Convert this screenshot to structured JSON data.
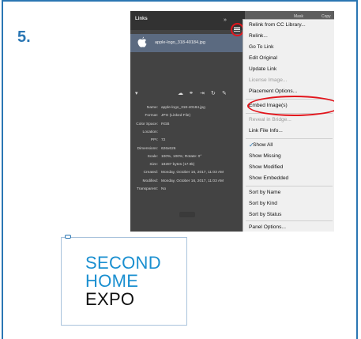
{
  "step_number": "5.",
  "panel": {
    "tab_label": "Links",
    "chevrons": "»",
    "link_filename": "apple-logo_318-40184.jpg",
    "info": [
      {
        "key": "Name:",
        "value": "apple-logo_318-40184.jpg"
      },
      {
        "key": "Format:",
        "value": "JPG (Linked File)"
      },
      {
        "key": "Color Space:",
        "value": "RGB"
      },
      {
        "key": "Location:",
        "value": ""
      },
      {
        "key": "PPI:",
        "value": "72"
      },
      {
        "key": "Dimensions:",
        "value": "626x626"
      },
      {
        "key": "Scale:",
        "value": "100%, 100%; Rotate: 0°"
      },
      {
        "key": "Size:",
        "value": "18287 bytes (17.9k)"
      },
      {
        "key": "Created:",
        "value": "Monday, October 16, 2017, 11:03 AM"
      },
      {
        "key": "Modified:",
        "value": "Monday, October 16, 2017, 11:03 AM"
      },
      {
        "key": "Transparent:",
        "value": "No"
      }
    ]
  },
  "background_columns": [
    "Mask",
    "Copy In"
  ],
  "menu": {
    "items": [
      {
        "label": "Relink from CC Library...",
        "disabled": false
      },
      {
        "label": "Relink...",
        "disabled": false
      },
      {
        "label": "Go To Link",
        "disabled": false
      },
      {
        "label": "Edit Original",
        "disabled": false
      },
      {
        "label": "Update Link",
        "disabled": false
      },
      {
        "label": "License Image...",
        "disabled": true
      },
      {
        "label": "Placement Options...",
        "disabled": false
      },
      {
        "label": "Embed Image(s)",
        "disabled": false
      },
      {
        "label": "Reveal in Bridge...",
        "disabled": true
      },
      {
        "label": "Link File Info...",
        "disabled": false
      },
      {
        "label": "Show All",
        "disabled": false,
        "checked": true
      },
      {
        "label": "Show Missing",
        "disabled": false
      },
      {
        "label": "Show Modified",
        "disabled": false
      },
      {
        "label": "Show Embedded",
        "disabled": false
      },
      {
        "label": "Sort by Name",
        "disabled": false
      },
      {
        "label": "Sort by Kind",
        "disabled": false
      },
      {
        "label": "Sort by Status",
        "disabled": false
      },
      {
        "label": "Panel Options...",
        "disabled": false
      }
    ]
  },
  "logo": {
    "lines": [
      "SECOND",
      "HOME",
      "EXPO"
    ],
    "colors": {
      "primary": "#1a8fd0",
      "secondary": "#111111"
    }
  },
  "colors": {
    "accent": "#2a76b3",
    "highlight_ring": "#e2141b",
    "selected_row": "#5b6a80"
  }
}
